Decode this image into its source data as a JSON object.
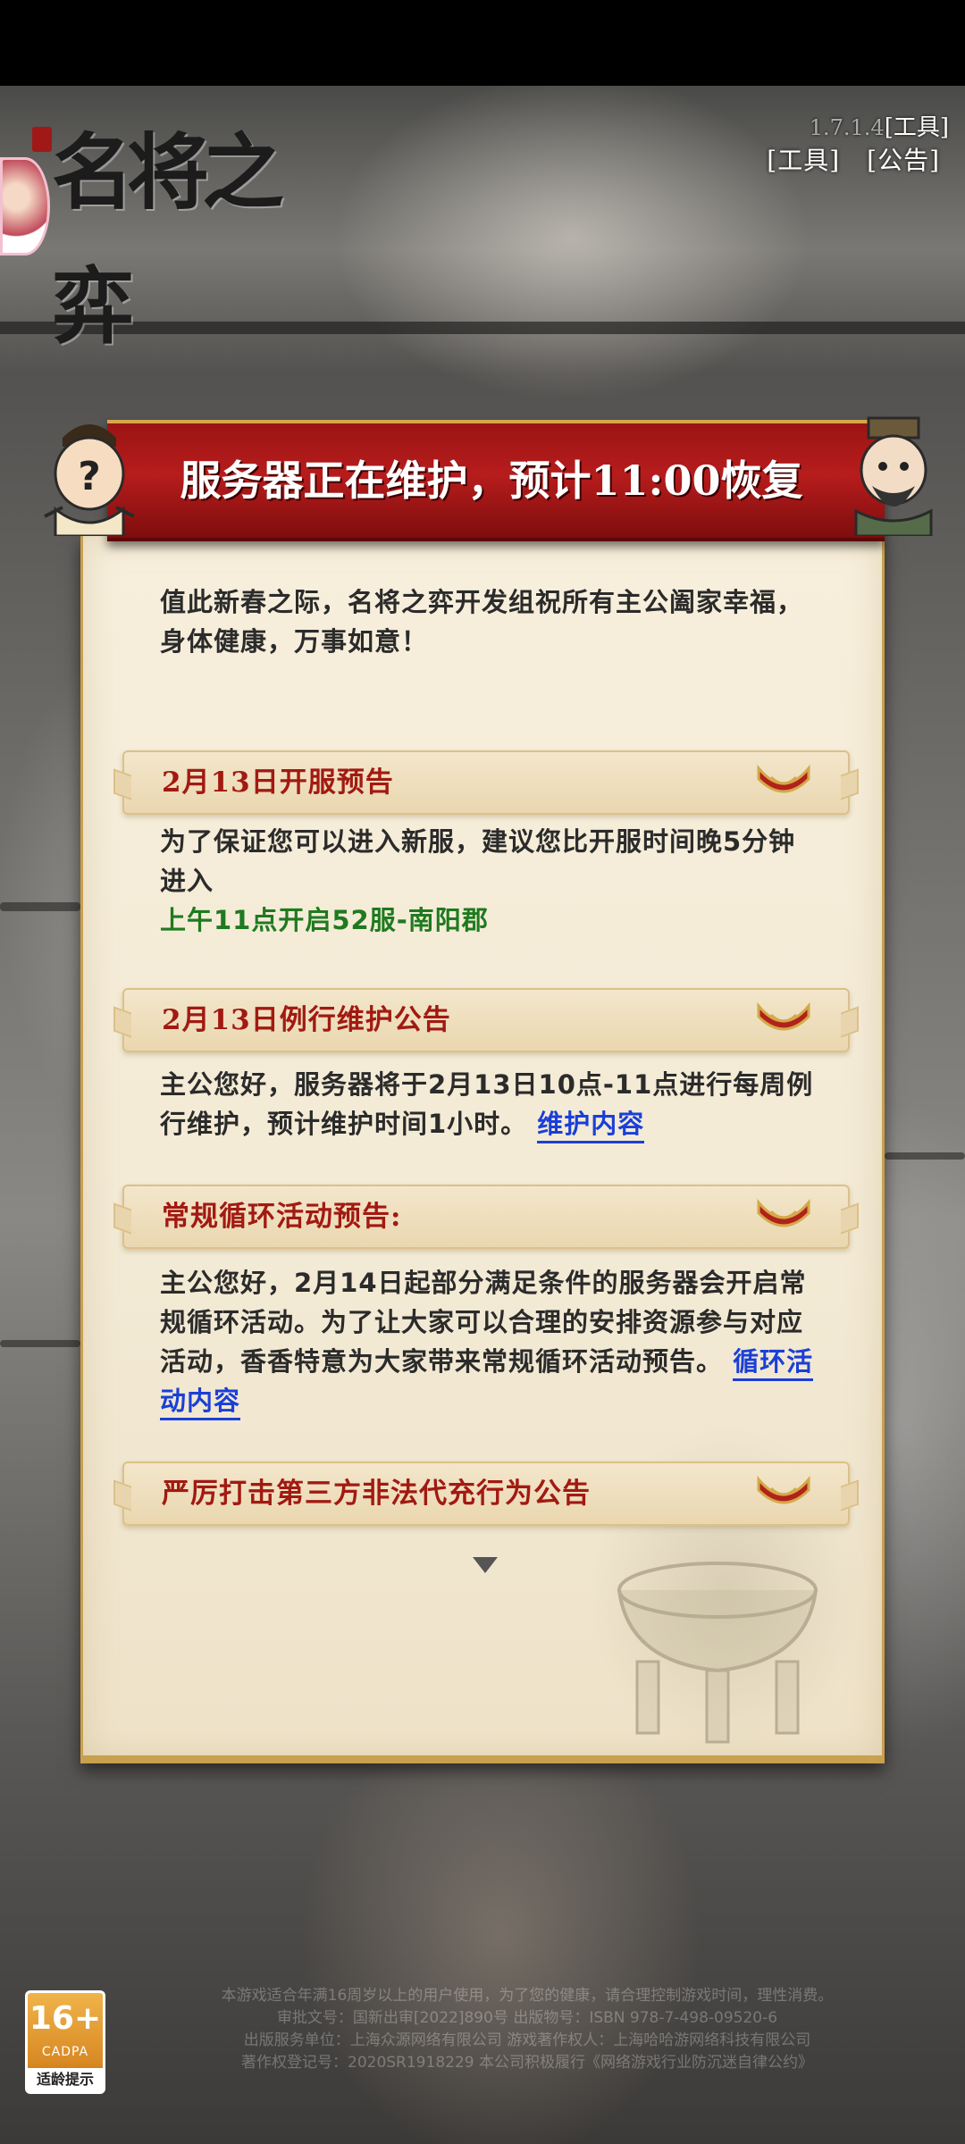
{
  "header": {
    "logo_text": "名将之弈",
    "version": "1.7.1.4",
    "tools_link_top": "[工具]",
    "tools_link": "[工具]",
    "notice_link": "[公告]"
  },
  "dialog": {
    "title": "服务器正在维护，预计11:00恢复",
    "greeting": "值此新春之际，名将之弈开发组祝所有主公阖家幸福，身体健康，万事如意！",
    "sections": [
      {
        "title": "2月13日开服预告",
        "body": "为了保证您可以进入新服，建议您比开服时间晚5分钟进入",
        "highlight": "上午11点开启52服-南阳郡"
      },
      {
        "title": "2月13日例行维护公告",
        "body": "主公您好，服务器将于2月13日10点-11点进行每周例行维护，预计维护时间1小时。",
        "link": "维护内容"
      },
      {
        "title": "常规循环活动预告:",
        "body": "主公您好，2月14日起部分满足条件的服务器会开启常规循环活动。为了让大家可以合理的安排资源参与对应活动，香香特意为大家带来常规循环活动预告。",
        "link": "循环活动内容"
      },
      {
        "title": "严厉打击第三方非法代充行为公告"
      }
    ]
  },
  "footer": {
    "age_rating": "16+",
    "age_org": "CADPA",
    "age_tip": "适龄提示",
    "lines": [
      "本游戏适合年满16周岁以上的用户使用，为了您的健康，请合理控制游戏时间，理性消费。",
      "审批文号：国新出审[2022]890号 出版物号：ISBN 978-7-498-09520-6",
      "出版服务单位：上海众源网络有限公司 游戏著作权人：上海哈哈游网络科技有限公司",
      "著作权登记号：2020SR1918229 本公司积极履行《网络游戏行业防沉迷自律公约》"
    ]
  },
  "colors": {
    "banner": "#b71c1c",
    "section_title": "#a11a12",
    "link": "#1a3fd8",
    "highlight": "#1f7a1f",
    "panel": "#f3ead5"
  }
}
